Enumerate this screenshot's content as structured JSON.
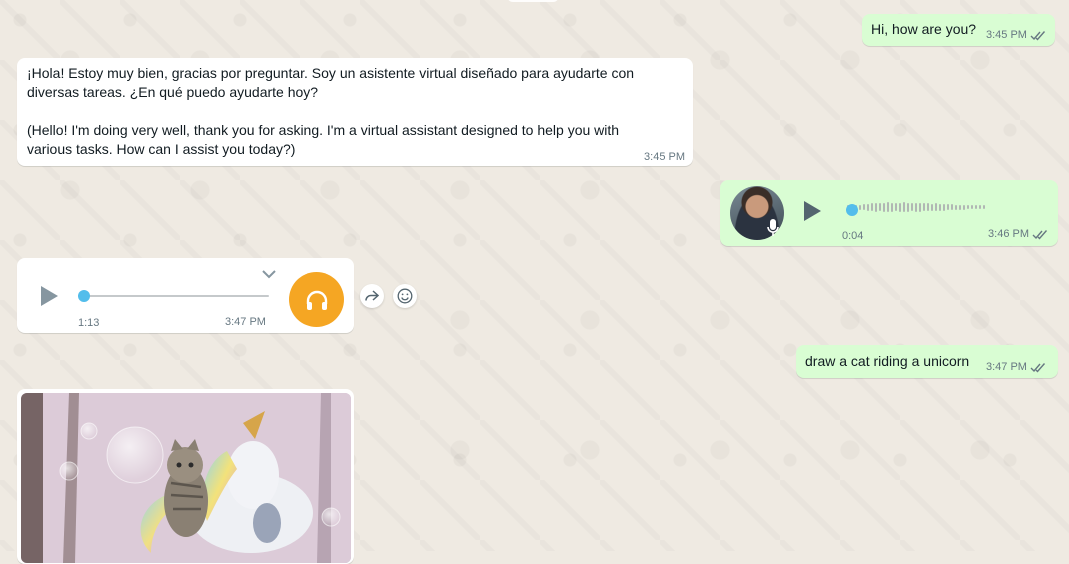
{
  "messages": [
    {
      "id": "m1",
      "direction": "outgoing",
      "text": "Hi, how are you?",
      "time": "3:45 PM",
      "status": "read"
    },
    {
      "id": "m2",
      "direction": "incoming",
      "text": "¡Hola! Estoy muy bien, gracias por preguntar. Soy un asistente virtual diseñado para ayudarte con\ndiversas tareas. ¿En qué puedo ayudarte hoy?\n\n(Hello! I'm doing very well, thank you for asking. I'm a virtual assistant designed to help you with\nvarious tasks. How can I assist you today?)",
      "time": "3:45 PM"
    },
    {
      "id": "m3",
      "direction": "outgoing",
      "type": "voice",
      "duration": "0:04",
      "time": "3:46 PM",
      "status": "read",
      "progress": 0
    },
    {
      "id": "m4",
      "direction": "incoming",
      "type": "voice",
      "duration": "1:13",
      "time": "3:47 PM",
      "progress": 0
    },
    {
      "id": "m5",
      "direction": "outgoing",
      "text": "draw a cat riding a unicorn",
      "time": "3:47 PM",
      "status": "read"
    },
    {
      "id": "m6",
      "direction": "incoming",
      "type": "image"
    }
  ],
  "icons": {
    "play": "play-icon",
    "mic": "microphone-icon",
    "chevron": "chevron-down-icon",
    "headphones": "headphones-icon",
    "forward": "forward-icon",
    "emoji": "emoji-icon",
    "ticks": "double-check-icon"
  },
  "colors": {
    "outgoing": "#d9fdd3",
    "incoming": "#ffffff",
    "read_tick": "#667781",
    "voice_dot": "#53bdeb",
    "headphones_bg": "#f5a623"
  }
}
